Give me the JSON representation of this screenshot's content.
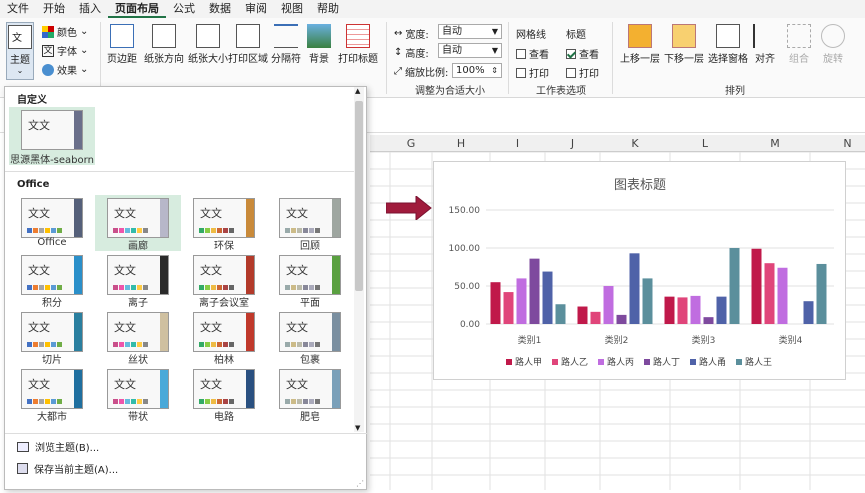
{
  "menu": [
    "文件",
    "开始",
    "插入",
    "页面布局",
    "公式",
    "数据",
    "审阅",
    "视图",
    "帮助"
  ],
  "active_menu": "页面布局",
  "ribbon": {
    "theme_btn": "主题",
    "colors": "颜色",
    "fonts": "字体",
    "effects": "效果",
    "margins": "页边距",
    "orientation": "纸张方向",
    "size": "纸张大小",
    "print_area": "打印区域",
    "breaks": "分隔符",
    "background": "背景",
    "print_titles": "打印标题",
    "width_label": "宽度:",
    "width_val": "自动",
    "height_label": "高度:",
    "height_val": "自动",
    "scale_label": "缩放比例:",
    "scale_val": "100%",
    "group_fit": "调整为合适大小",
    "gridlines": "网格线",
    "headings": "标题",
    "view": "查看",
    "print": "打印",
    "group_sheet": "工作表选项",
    "bring_forward": "上移一层",
    "send_backward": "下移一层",
    "selection_pane": "选择窗格",
    "align": "对齐",
    "group_btn": "组合",
    "rotate": "旋转",
    "group_arrange": "排列"
  },
  "columns": [
    "G",
    "H",
    "I",
    "J",
    "K",
    "L",
    "M",
    "N"
  ],
  "panel": {
    "custom_header": "自定义",
    "custom_theme": "思源黑体-seaborn",
    "office_header": "Office",
    "themes": [
      "Office",
      "画廊",
      "环保",
      "回顾",
      "积分",
      "离子",
      "离子会议室",
      "平面",
      "切片",
      "丝状",
      "柏林",
      "包裹",
      "大都市",
      "带状",
      "电路",
      "肥皂"
    ],
    "thumb_text": "文文",
    "browse": "浏览主题(B)...",
    "save": "保存当前主题(A)..."
  },
  "colors": {
    "accent": "#217346",
    "arrow": "#a01b3c"
  },
  "chart_data": {
    "type": "bar",
    "title": "图表标题",
    "categories": [
      "类别1",
      "类别2",
      "类别3",
      "类别4"
    ],
    "ylim": [
      0,
      150
    ],
    "yticks": [
      "0.00",
      "50.00",
      "100.00",
      "150.00"
    ],
    "legend_position": "bottom",
    "grid": true,
    "series": [
      {
        "name": "路人甲",
        "color": "#c0194a",
        "values": [
          55,
          23,
          36,
          99
        ]
      },
      {
        "name": "路人乙",
        "color": "#e0457a",
        "values": [
          42,
          16,
          35,
          80
        ]
      },
      {
        "name": "路人丙",
        "color": "#c06de0",
        "values": [
          60,
          50,
          37,
          74
        ]
      },
      {
        "name": "路人丁",
        "color": "#7e4a9e",
        "values": [
          86,
          12,
          9,
          0
        ]
      },
      {
        "name": "路人甬",
        "color": "#4f62a8",
        "values": [
          69,
          93,
          36,
          30
        ]
      },
      {
        "name": "路人王",
        "color": "#5b8f9c",
        "values": [
          26,
          60,
          100,
          79
        ]
      }
    ]
  }
}
